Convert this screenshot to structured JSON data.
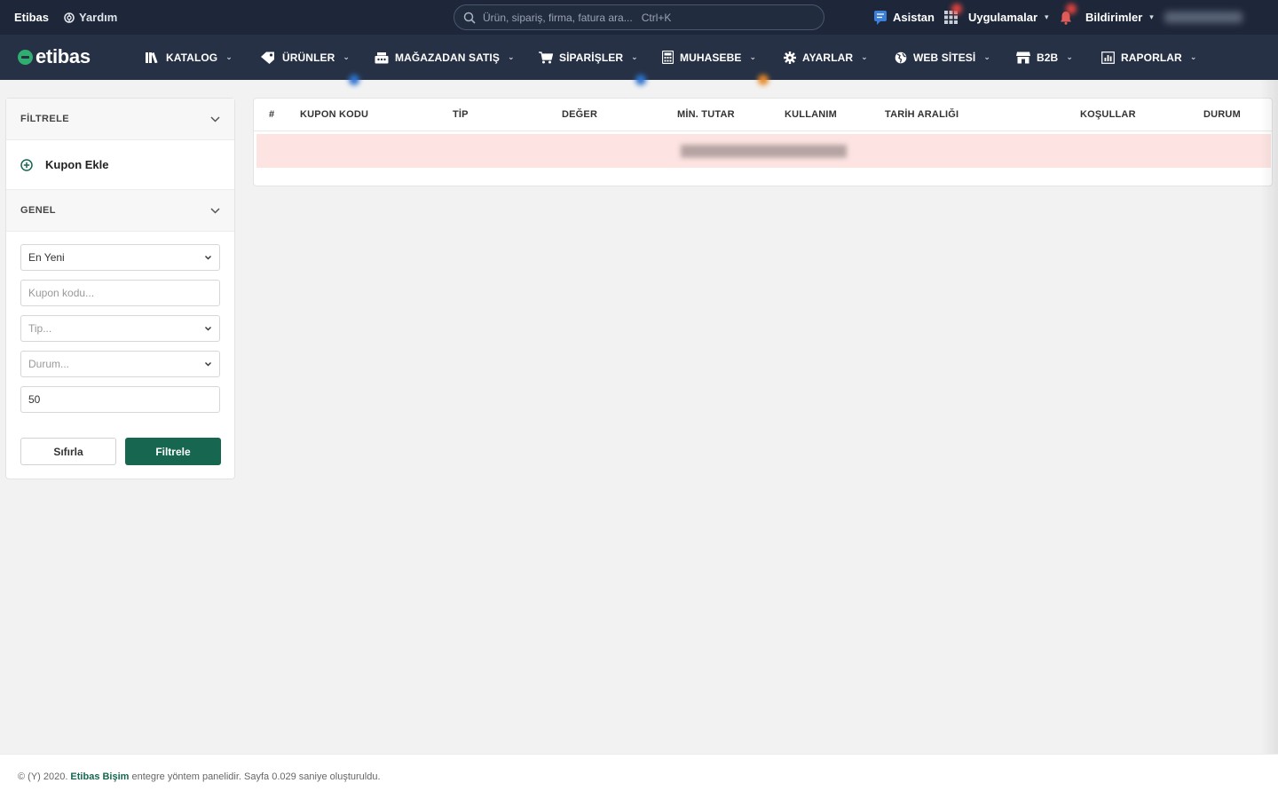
{
  "topbar": {
    "brand": "Etibas",
    "help": "Yardım",
    "search_placeholder": "Ürün, sipariş, firma, fatura ara...   Ctrl+K",
    "assistant": "Asistan",
    "apps": "Uygulamalar",
    "notifications": "Bildirimler"
  },
  "logo": "etibas",
  "nav": [
    {
      "label": "KATALOG",
      "icon": "books-icon"
    },
    {
      "label": "ÜRÜNLER",
      "icon": "tag-icon"
    },
    {
      "label": "MAĞAZADAN SATIŞ",
      "icon": "cash-register-icon"
    },
    {
      "label": "SİPARİŞLER",
      "icon": "cart-icon"
    },
    {
      "label": "MUHASEBE",
      "icon": "calculator-icon"
    },
    {
      "label": "AYARLAR",
      "icon": "gear-icon"
    },
    {
      "label": "WEB SİTESİ",
      "icon": "globe-icon"
    },
    {
      "label": "B2B",
      "icon": "store-icon"
    },
    {
      "label": "RAPORLAR",
      "icon": "report-icon"
    }
  ],
  "sidebar": {
    "filter_title": "FİLTRELE",
    "add_coupon": "Kupon Ekle",
    "general_title": "GENEL",
    "sort_value": "En Yeni",
    "coupon_placeholder": "Kupon kodu...",
    "type_placeholder": "Tip...",
    "status_placeholder": "Durum...",
    "limit_value": "50",
    "reset_label": "Sıfırla",
    "filter_label": "Filtrele"
  },
  "table": {
    "columns": [
      "#",
      "KUPON KODU",
      "TİP",
      "DEĞER",
      "MİN. TUTAR",
      "KULLANIM",
      "TARİH ARALIĞI",
      "KOŞULLAR",
      "DURUM"
    ]
  },
  "footer": {
    "prefix": "© (Y) 2020.",
    "link": "Etibas Bişim",
    "suffix": "entegre yöntem panelidir. Sayfa 0.029 saniye oluşturuldu."
  },
  "colors": {
    "topbar": "#1d2739",
    "navbar": "#263145",
    "primary": "#176650",
    "empty_row": "#fde4e2"
  }
}
